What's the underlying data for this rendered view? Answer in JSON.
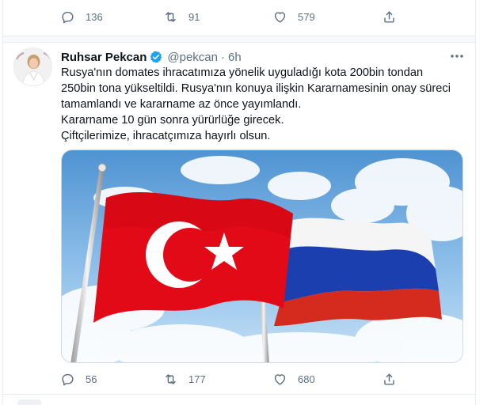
{
  "previous_tweet": {
    "reply_count": "136",
    "retweet_count": "91",
    "like_count": "579"
  },
  "tweet": {
    "display_name": "Ruhsar Pekcan",
    "handle": "@pekcan",
    "separator": "·",
    "time": "6h",
    "text_lines": [
      "Rusya'nın domates ihracatımıza yönelik uyguladığı kota 200bin tondan",
      "250bin tona yükseltildi. Rusya'nın konuya ilişkin Kararnamesinin onay süreci",
      "tamamlandı ve kararname  az önce yayımlandı.",
      "Kararname 10 gün sonra yürürlüğe girecek.",
      "Çiftçilerimize, ihracatçımıza hayırlı olsun."
    ],
    "reply_count": "56",
    "retweet_count": "177",
    "like_count": "680",
    "icons": {
      "verified": "verified-badge-icon",
      "more": "more-options-icon",
      "reply": "reply-icon",
      "retweet": "retweet-icon",
      "like": "heart-icon",
      "share": "share-icon"
    }
  },
  "colors": {
    "muted_text": "#5b7083",
    "verified_blue": "#1da1f2",
    "border": "#e6ecf0",
    "turkish_red": "#e30a17",
    "russian_blue": "#1c3fb0",
    "russian_red": "#d52b1e"
  }
}
